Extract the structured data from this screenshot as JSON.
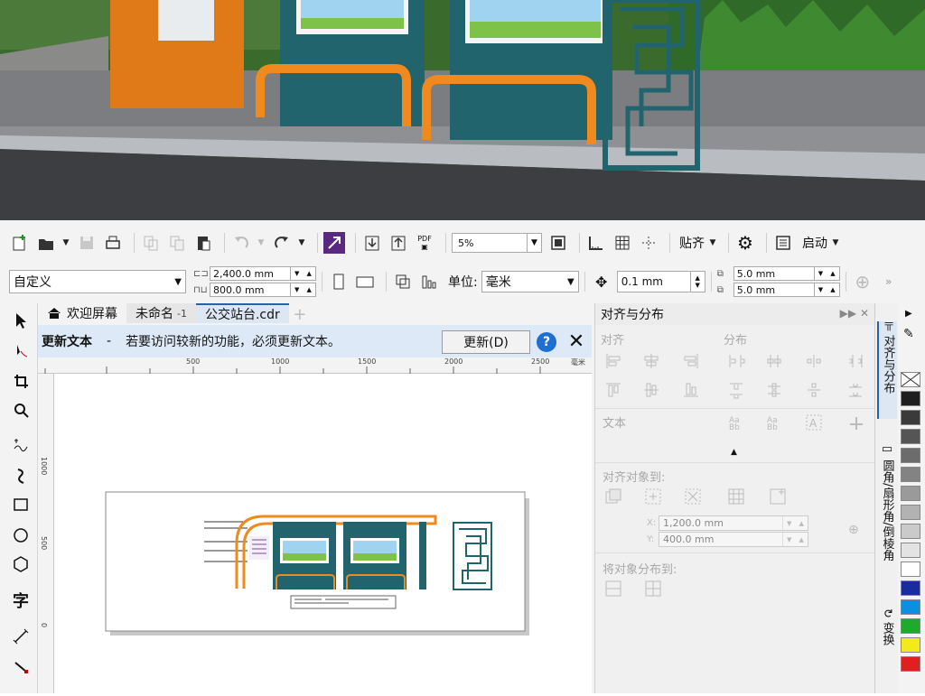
{
  "toolbar": {
    "zoom_value": "5%",
    "snap_label": "贴齐",
    "launch_label": "启动"
  },
  "property_bar": {
    "preset": "自定义",
    "width": "2,400.0 mm",
    "height": "800.0 mm",
    "units_label": "单位:",
    "units_value": "毫米",
    "nudge": "0.1 mm",
    "dup_x": "5.0 mm",
    "dup_y": "5.0 mm"
  },
  "tabs": [
    {
      "label": "欢迎屏幕"
    },
    {
      "label": "未命名",
      "sub": "-1"
    },
    {
      "label": "公交站台.cdr"
    }
  ],
  "notification": {
    "title": "更新文本",
    "separator": "-",
    "message": "若要访问较新的功能，必须更新文本。",
    "button": "更新(D)",
    "help": "?",
    "close": "✕"
  },
  "ruler": {
    "h_ticks": [
      "500",
      "1000",
      "1500",
      "2000",
      "2500"
    ],
    "unit": "毫米",
    "v_ticks": [
      "1000",
      "500",
      "0"
    ]
  },
  "docker": {
    "title": "对齐与分布",
    "align_section": "对齐",
    "distribute_section": "分布",
    "text_section": "文本",
    "align_to_section": "对齐对象到:",
    "field_x_label": "X:",
    "field_x": "1,200.0 mm",
    "field_y_label": "Y:",
    "field_y": "400.0 mm",
    "distribute_to_section": "将对象分布到:"
  },
  "vertical_tabs": [
    {
      "label": "对齐与分布"
    },
    {
      "label": "圆角/扇形角/倒棱角"
    },
    {
      "label": "变换"
    }
  ],
  "tools": {
    "text_tool": "字"
  },
  "palette": [
    "#ffffff",
    "#1e1e1e",
    "#3a3a3a",
    "#555555",
    "#6c6c6c",
    "#838383",
    "#9a9a9a",
    "#b2b2b2",
    "#cacaca",
    "#e3e3e3",
    "#ffffff",
    "#1a2aa0",
    "#0c8fe0",
    "#1faa2a",
    "#f2ea1a",
    "#e02020"
  ],
  "colors": {
    "accent": "#2a5faa",
    "notif_bg": "#dde9f6",
    "shelter_teal": "#21646e",
    "shelter_orange": "#f08a1e"
  },
  "icons": [
    "new-icon",
    "open-icon",
    "save-icon",
    "print-icon",
    "import-icon",
    "export-icon",
    "pdf-icon",
    "undo-icon",
    "redo-icon",
    "options-icon",
    "pick-tool-icon",
    "shape-tool-icon",
    "crop-tool-icon",
    "zoom-tool-icon",
    "freehand-tool-icon",
    "artistic-media-icon",
    "rectangle-tool-icon",
    "ellipse-tool-icon",
    "polygon-tool-icon",
    "dimension-tool-icon",
    "connector-tool-icon"
  ]
}
